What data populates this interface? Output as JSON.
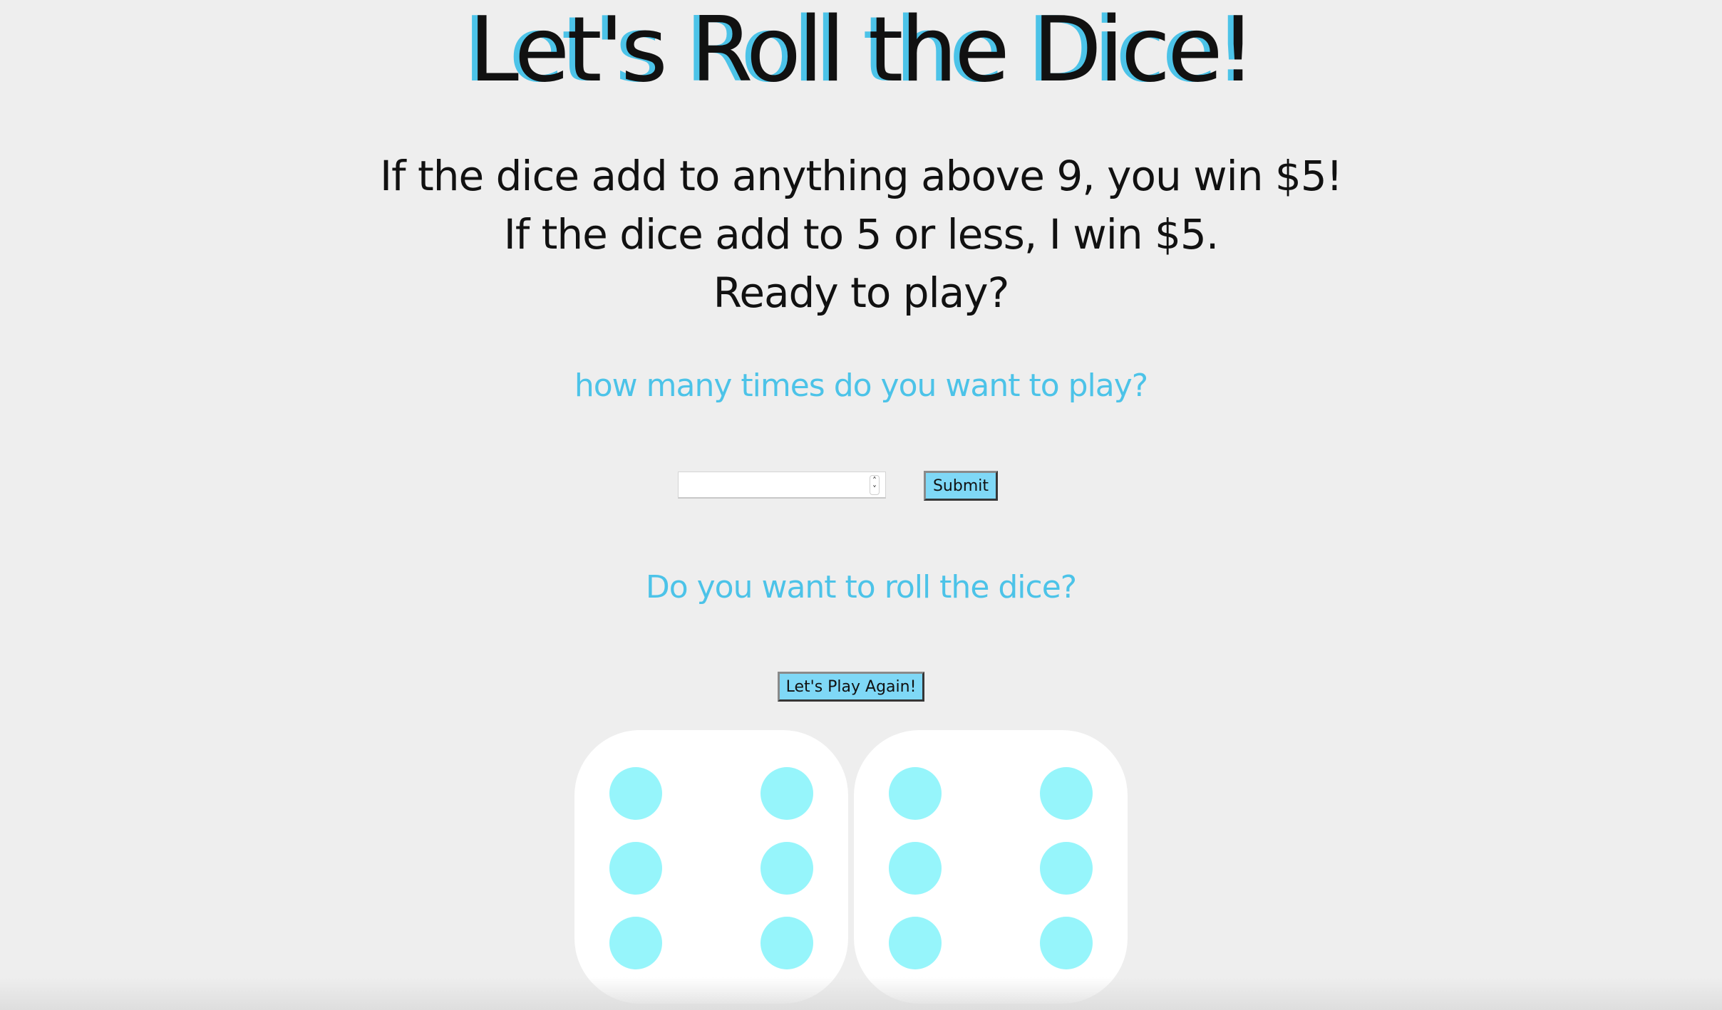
{
  "header": {
    "title": "Let's Roll the Dice!"
  },
  "rules": {
    "line1": "If the dice add to anything above 9, you win $5!",
    "line2": "If the dice add to 5 or less, I win $5.",
    "line3": "Ready to play?"
  },
  "play_count": {
    "prompt": "how many times do you want to play?",
    "input_value": "",
    "input_placeholder": "",
    "stepper_up": "˄",
    "stepper_down": "˅",
    "submit_label": "Submit"
  },
  "roll": {
    "prompt": "Do you want to roll the dice?",
    "play_again_label": "Let's Play Again!"
  },
  "dice": {
    "die1_value": 6,
    "die2_value": 6
  },
  "colors": {
    "accent": "#4cc3e8",
    "pip": "#96f5fb",
    "button": "#7fd8f6",
    "background": "#eeeeee"
  }
}
